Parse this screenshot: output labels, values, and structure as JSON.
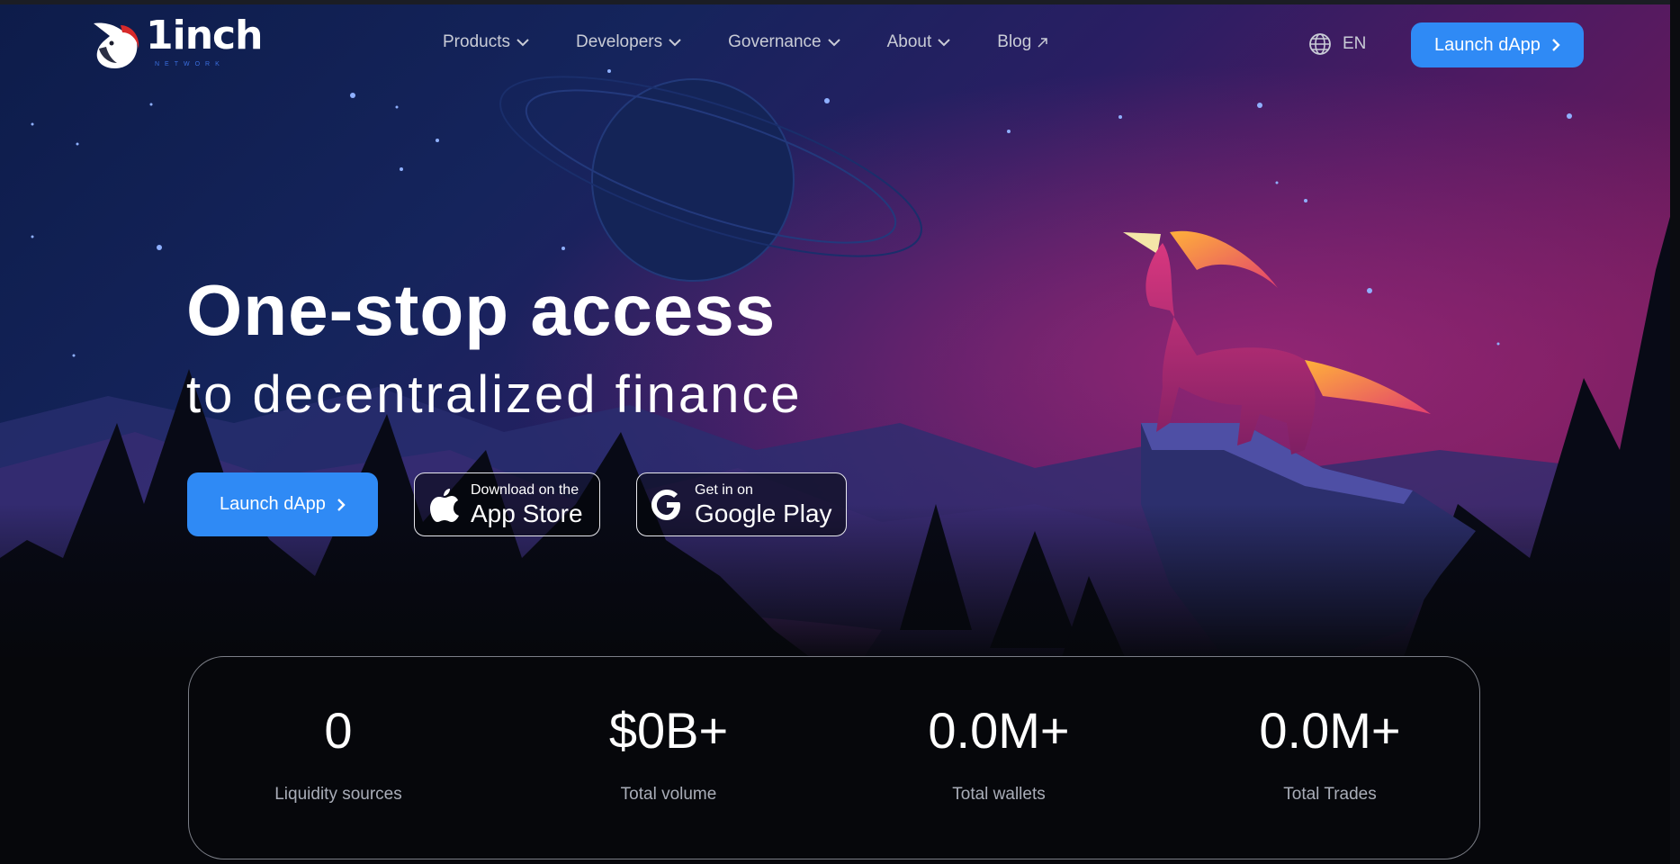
{
  "brand": {
    "name": "1inch",
    "tagline": "NETWORK",
    "accent": "#2f8af5",
    "logo_icon": "unicorn-logo-icon"
  },
  "nav": {
    "items": [
      {
        "label": "Products",
        "icon": "chevron-down-icon"
      },
      {
        "label": "Developers",
        "icon": "chevron-down-icon"
      },
      {
        "label": "Governance",
        "icon": "chevron-down-icon"
      },
      {
        "label": "About",
        "icon": "chevron-down-icon"
      },
      {
        "label": "Blog",
        "icon": "external-link-arrow-icon"
      }
    ],
    "language": "EN",
    "language_icon": "globe-icon",
    "cta_label": "Launch dApp"
  },
  "hero": {
    "headline": "One-stop access",
    "subheadline": "to decentralized finance",
    "cta_label": "Launch dApp",
    "app_store": {
      "small": "Download on the",
      "big": "App Store",
      "icon": "apple-icon"
    },
    "google_play": {
      "small": "Get in on",
      "big": "Google Play",
      "icon": "google-g-icon"
    }
  },
  "stats": [
    {
      "value": "0",
      "label": "Liquidity sources"
    },
    {
      "value": "$0B+",
      "label": "Total volume"
    },
    {
      "value": "0.0M+",
      "label": "Total wallets"
    },
    {
      "value": "0.0M+",
      "label": "Total Trades"
    }
  ]
}
